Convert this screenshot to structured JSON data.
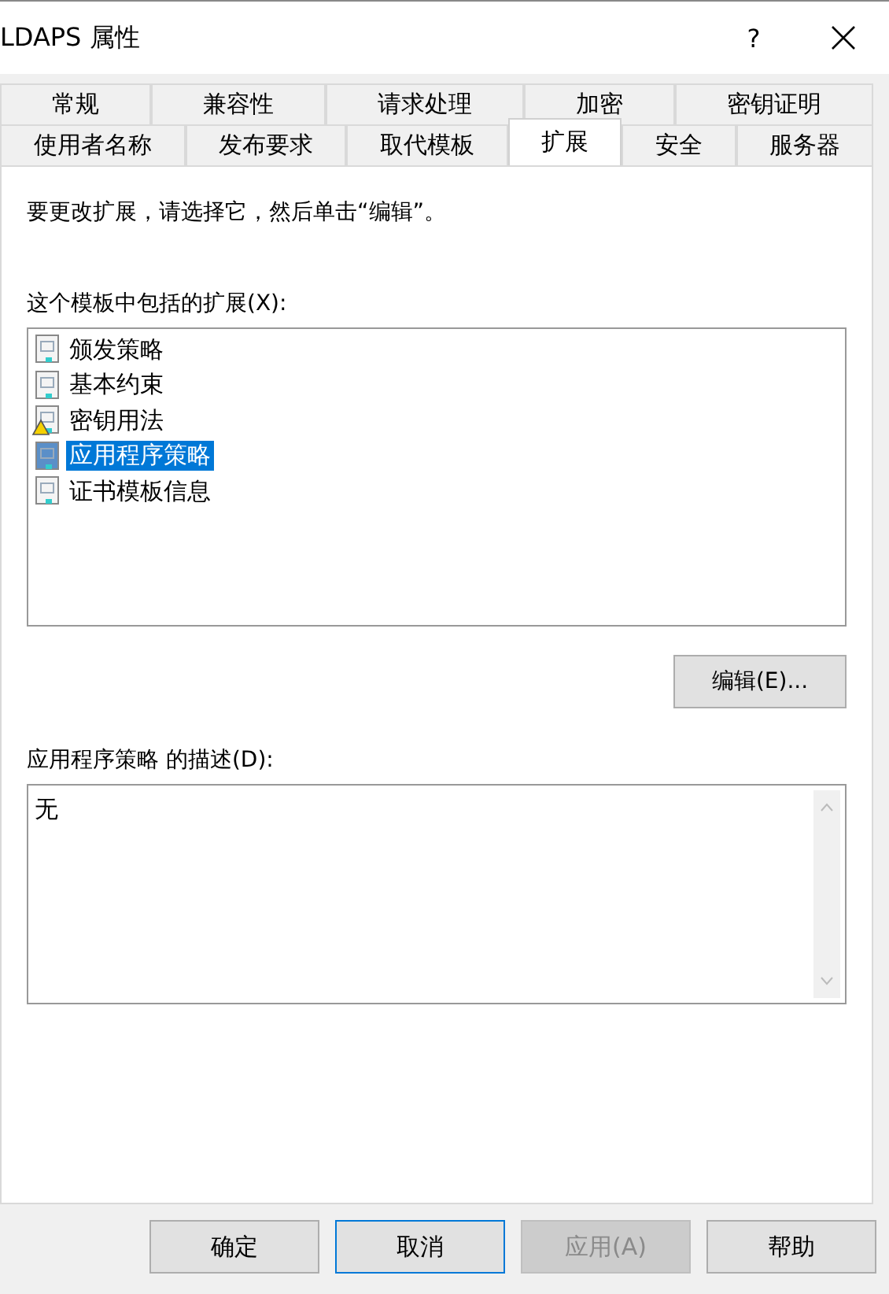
{
  "window": {
    "title": "LDAPS 属性",
    "help": "?"
  },
  "tab_rows": [
    [
      {
        "label": "常规",
        "selected": false
      },
      {
        "label": "兼容性",
        "selected": false
      },
      {
        "label": "请求处理",
        "selected": false
      },
      {
        "label": "加密",
        "selected": false
      },
      {
        "label": "密钥证明",
        "selected": false
      }
    ],
    [
      {
        "label": "使用者名称",
        "selected": false
      },
      {
        "label": "发布要求",
        "selected": false
      },
      {
        "label": "取代模板",
        "selected": false
      },
      {
        "label": "扩展",
        "selected": true
      },
      {
        "label": "安全",
        "selected": false
      },
      {
        "label": "服务器",
        "selected": false
      }
    ]
  ],
  "instruction": "要更改扩展，请选择它，然后单击“编辑”。",
  "extensions": {
    "label": "这个模板中包括的扩展(X):",
    "items": [
      {
        "name": "颁发策略",
        "kind": "normal",
        "selected": false
      },
      {
        "name": "基本约束",
        "kind": "normal",
        "selected": false
      },
      {
        "name": "密钥用法",
        "kind": "warning",
        "selected": false
      },
      {
        "name": "应用程序策略",
        "kind": "normal",
        "selected": true
      },
      {
        "name": "证书模板信息",
        "kind": "normal",
        "selected": false
      }
    ]
  },
  "edit_button": "编辑(E)...",
  "description": {
    "label": "应用程序策略 的描述(D):",
    "value": "无"
  },
  "buttons": [
    {
      "label": "确定",
      "disabled": false,
      "focused": false
    },
    {
      "label": "取消",
      "disabled": false,
      "focused": true
    },
    {
      "label": "应用(A)",
      "disabled": true,
      "focused": false
    },
    {
      "label": "帮助",
      "disabled": false,
      "focused": false
    }
  ]
}
